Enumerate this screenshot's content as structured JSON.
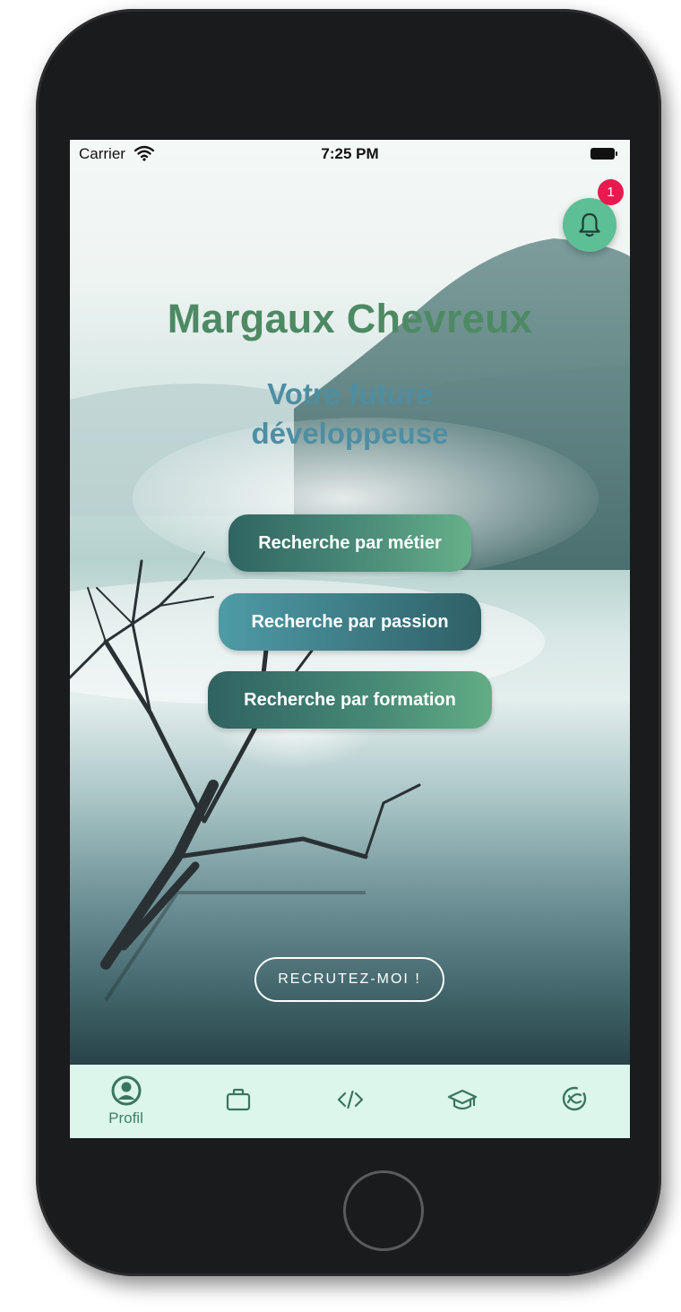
{
  "status_bar": {
    "carrier": "Carrier",
    "time": "7:25 PM"
  },
  "notifications": {
    "badge_count": "1"
  },
  "header": {
    "name": "Margaux Chevreux",
    "subtitle_line1": "Votre future",
    "subtitle_line2": "développeuse"
  },
  "search_buttons": {
    "by_job": "Recherche par métier",
    "by_passion": "Recherche par passion",
    "by_training": "Recherche par formation"
  },
  "cta": {
    "recruit_label": "RECRUTEZ-MOI !"
  },
  "tab_bar": {
    "tabs": [
      {
        "label": "Profil",
        "icon": "profile-icon",
        "active": true
      },
      {
        "label": "",
        "icon": "briefcase-icon",
        "active": false
      },
      {
        "label": "",
        "icon": "code-icon",
        "active": false
      },
      {
        "label": "",
        "icon": "graduation-cap-icon",
        "active": false
      },
      {
        "label": "",
        "icon": "hobbies-icon",
        "active": false
      }
    ]
  },
  "colors": {
    "accent_green": "#5dbf96",
    "title_green": "#4d8a64",
    "subtitle_teal": "#4e8ea2",
    "tab_bar_bg": "#dcf6ec",
    "badge_red": "#e8194f"
  }
}
